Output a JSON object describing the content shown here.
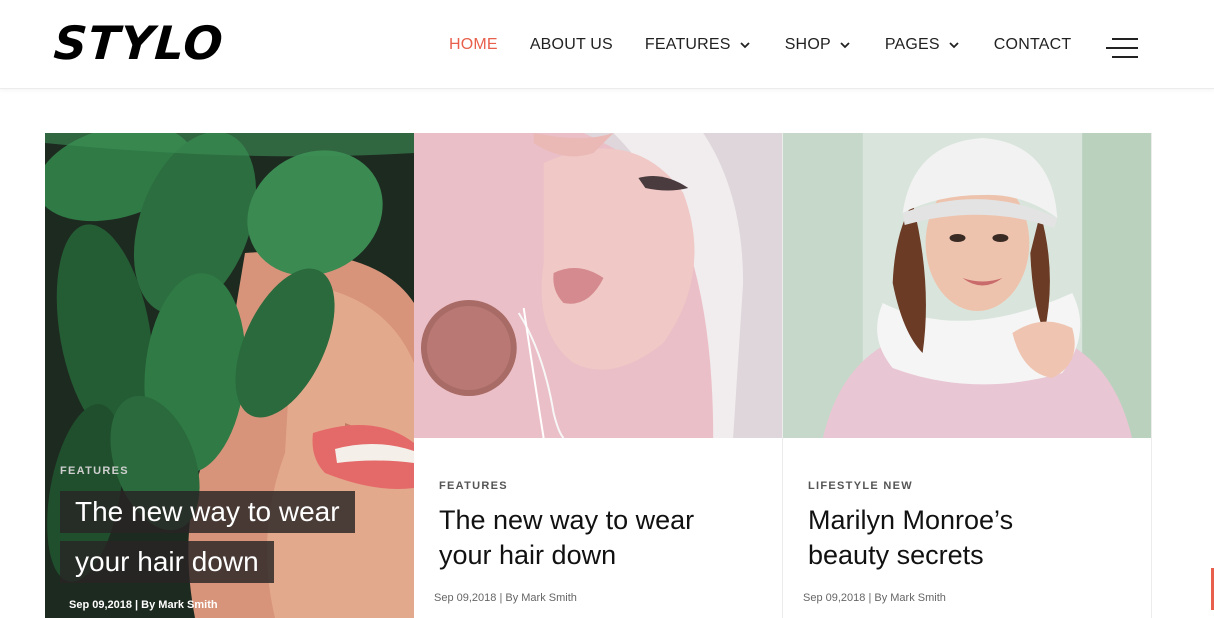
{
  "brand": {
    "logo_text": "STYLO"
  },
  "nav": {
    "items": [
      {
        "label": "HOME",
        "active": true,
        "has_dropdown": false
      },
      {
        "label": "ABOUT US",
        "active": false,
        "has_dropdown": false
      },
      {
        "label": "FEATURES",
        "active": false,
        "has_dropdown": true
      },
      {
        "label": "SHOP",
        "active": false,
        "has_dropdown": true
      },
      {
        "label": "PAGES",
        "active": false,
        "has_dropdown": true
      },
      {
        "label": "CONTACT",
        "active": false,
        "has_dropdown": false
      }
    ],
    "menu_icon": "hamburger-menu-icon"
  },
  "colors": {
    "accent": "#e8604c",
    "text": "#111111",
    "overlay": "#282424"
  },
  "posts": [
    {
      "category": "FEATURES",
      "title_lines": [
        "The new way to wear",
        "your hair down"
      ],
      "meta": "Sep 09,2018 | By Mark Smith",
      "image": "woman-with-green-leaves-photo"
    },
    {
      "category": "FEATURES",
      "title_lines": [
        "The new way to wear",
        "your hair down"
      ],
      "meta": "Sep 09,2018 | By Mark Smith",
      "image": "woman-with-pink-powder-puff-photo"
    },
    {
      "category": "LIFESTYLE NEW",
      "title_lines": [
        "Marilyn Monroe’s",
        "beauty secrets"
      ],
      "meta": "Sep 09,2018 | By Mark Smith",
      "image": "woman-in-white-knit-hat-photo"
    }
  ]
}
